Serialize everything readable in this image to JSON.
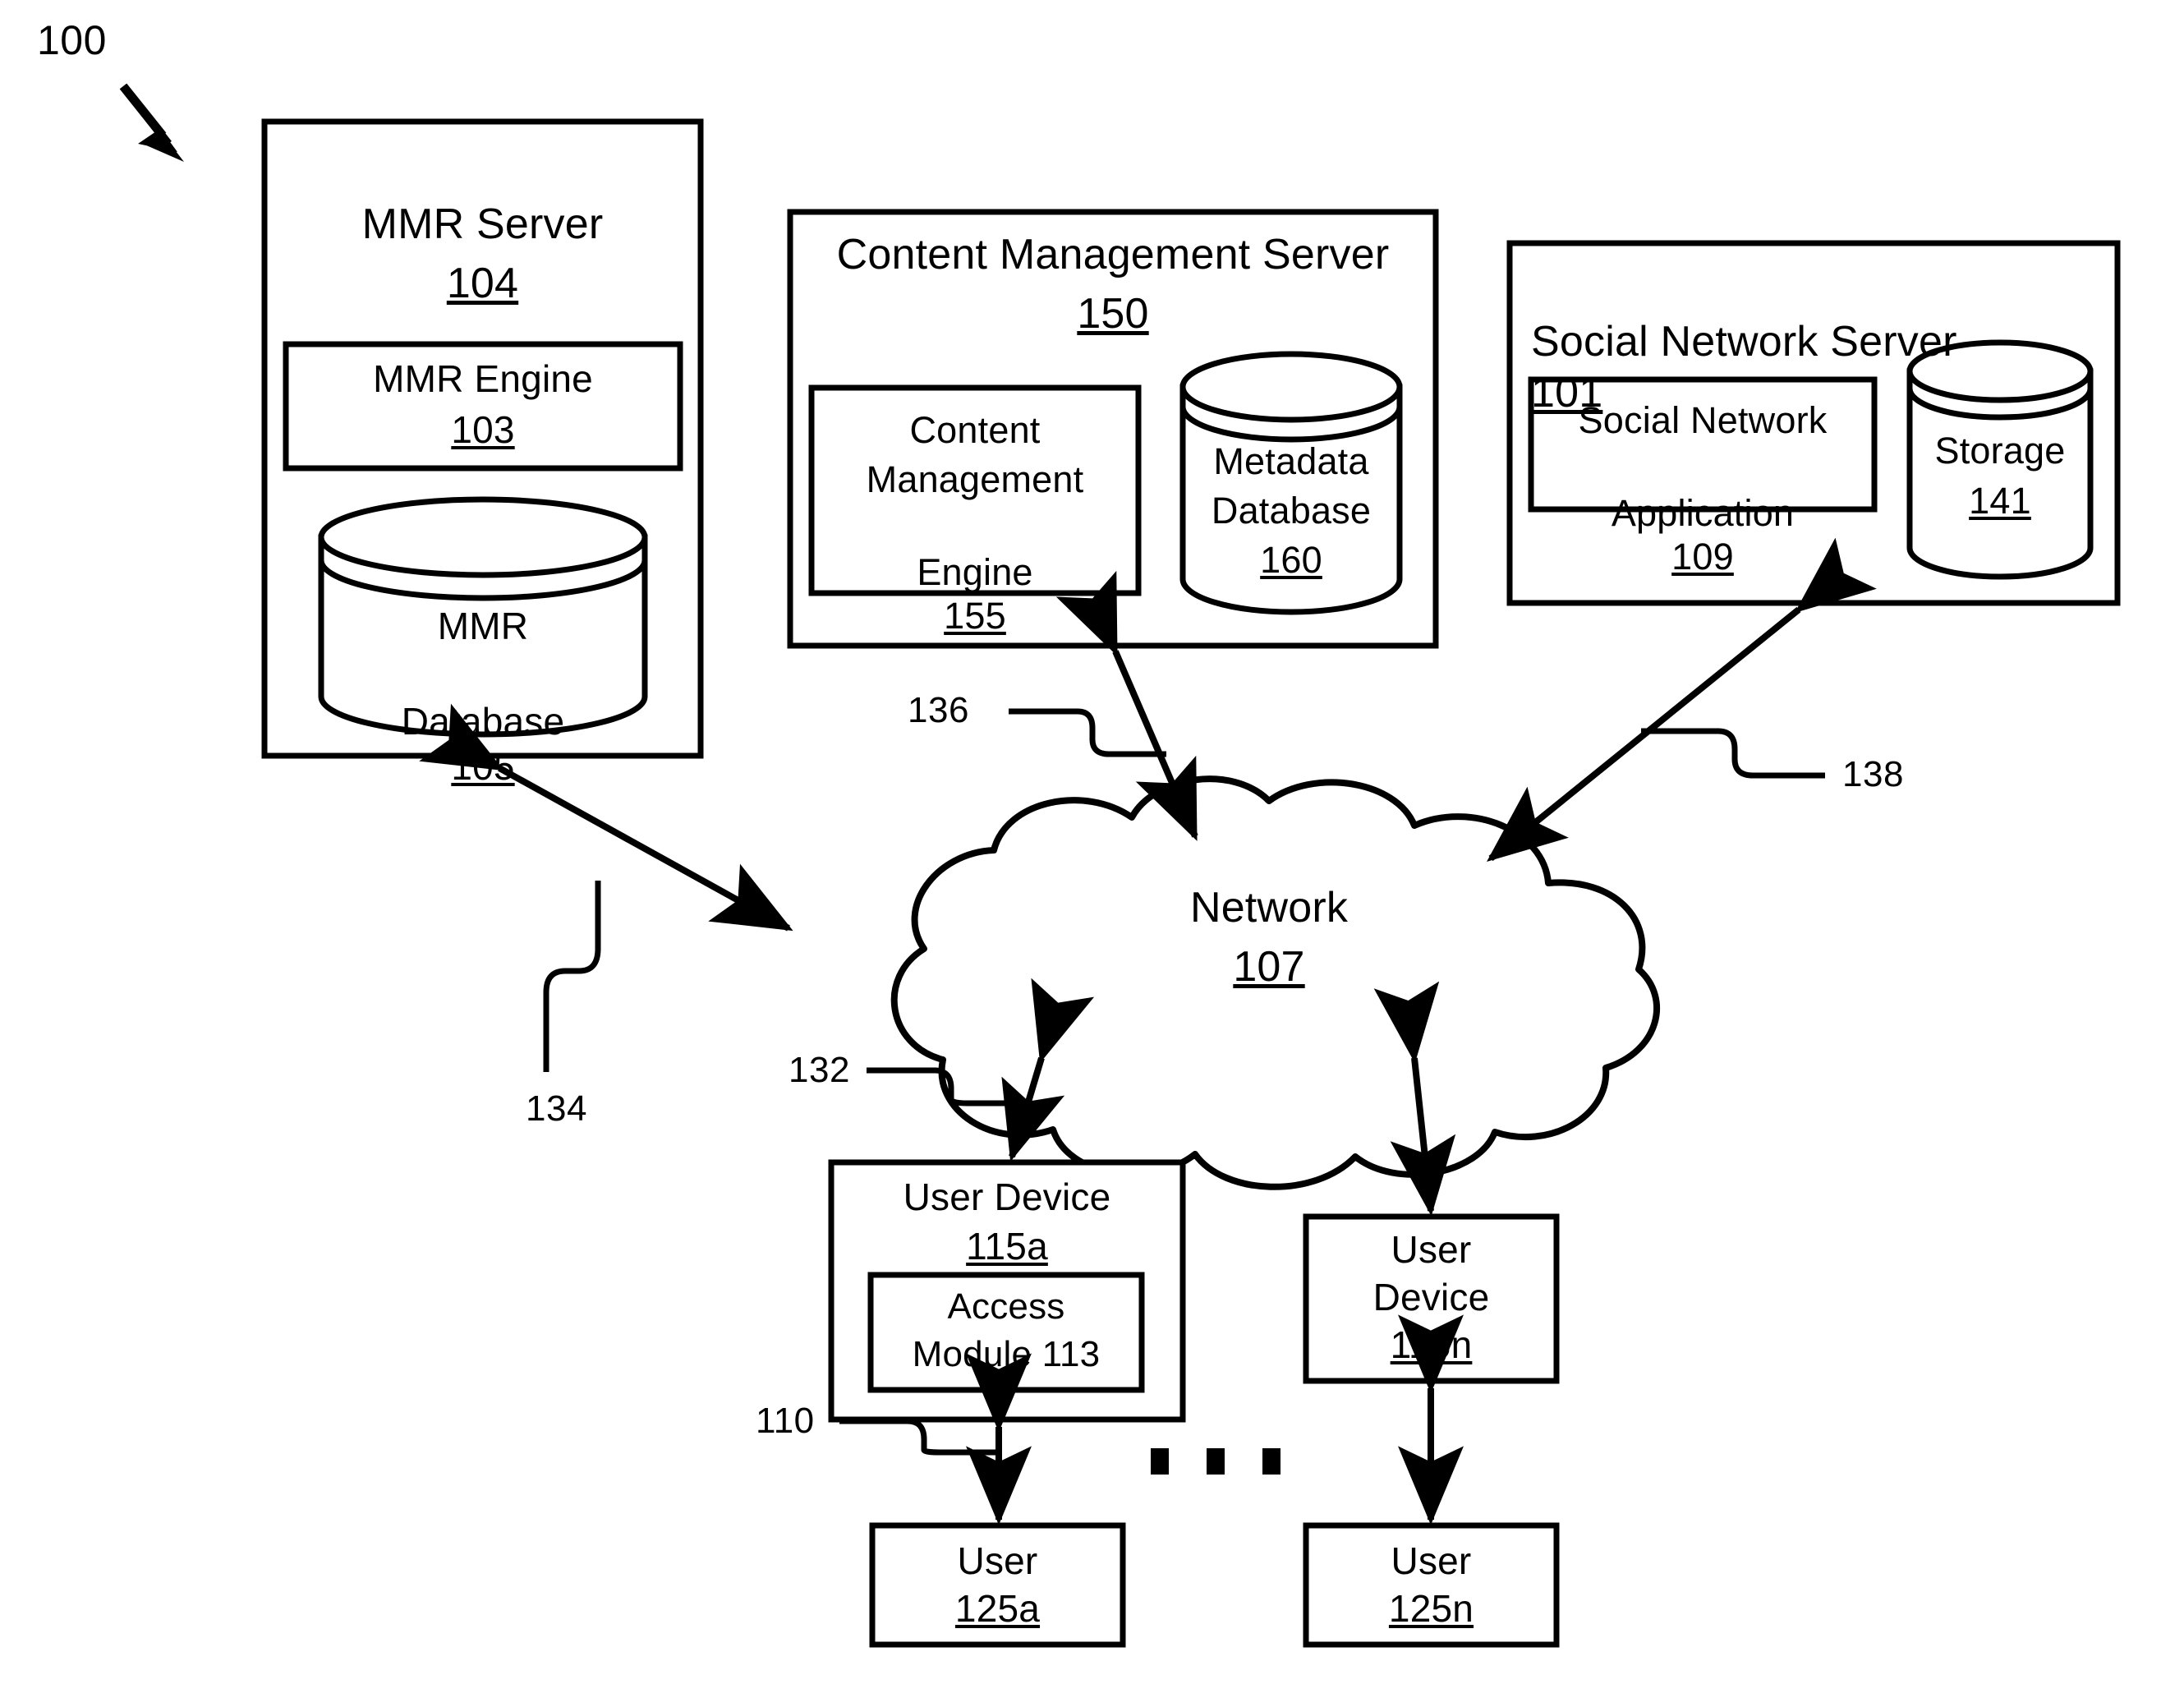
{
  "figure": {
    "id": "100",
    "type": "patent-system-architecture-diagram",
    "title_ref": "100"
  },
  "nodes": {
    "mmr_server": {
      "name": "MMR Server",
      "ref": "104",
      "children": {
        "mmr_engine": {
          "name": "MMR Engine",
          "ref": "103"
        },
        "mmr_database": {
          "name": "MMR",
          "name2": "Database",
          "ref": "105"
        }
      }
    },
    "content_management_server": {
      "name": "Content Management Server",
      "ref": "150",
      "children": {
        "content_management_engine": {
          "name": "Content",
          "name2": "Management",
          "name3": "Engine",
          "ref": "155"
        },
        "metadata_database": {
          "name": "Metadata",
          "name2": "Database",
          "ref": "160"
        }
      }
    },
    "social_network_server": {
      "name": "Social Network Server",
      "ref": "101",
      "children": {
        "social_network_application": {
          "name": "Social Network",
          "name2": "Application",
          "ref": "109"
        },
        "storage": {
          "name": "Storage",
          "ref": "141"
        }
      }
    },
    "network": {
      "name": "Network",
      "ref": "107"
    },
    "user_device_a": {
      "name": "User Device",
      "ref": "115a",
      "children": {
        "access_module": {
          "name": "Access",
          "name2": "Module 113"
        }
      }
    },
    "user_device_n": {
      "name": "User",
      "name2": "Device",
      "ref": "115n"
    },
    "user_a": {
      "name": "User",
      "ref": "125a"
    },
    "user_n": {
      "name": "User",
      "ref": "125n"
    }
  },
  "connectors": {
    "c134": {
      "ref": "134",
      "from": "mmr_server",
      "to": "network"
    },
    "c136": {
      "ref": "136",
      "from": "content_management_server",
      "to": "network"
    },
    "c138": {
      "ref": "138",
      "from": "social_network_server",
      "to": "network"
    },
    "c132": {
      "ref": "132",
      "from": "network",
      "to": "user_device_a"
    },
    "c110": {
      "ref": "110",
      "from": "user_device_a",
      "to": "user_a"
    }
  },
  "ellipsis": "▪ ▪ ▪",
  "colors": {
    "stroke": "#000000",
    "fill": "#ffffff",
    "background": "#ffffff"
  }
}
